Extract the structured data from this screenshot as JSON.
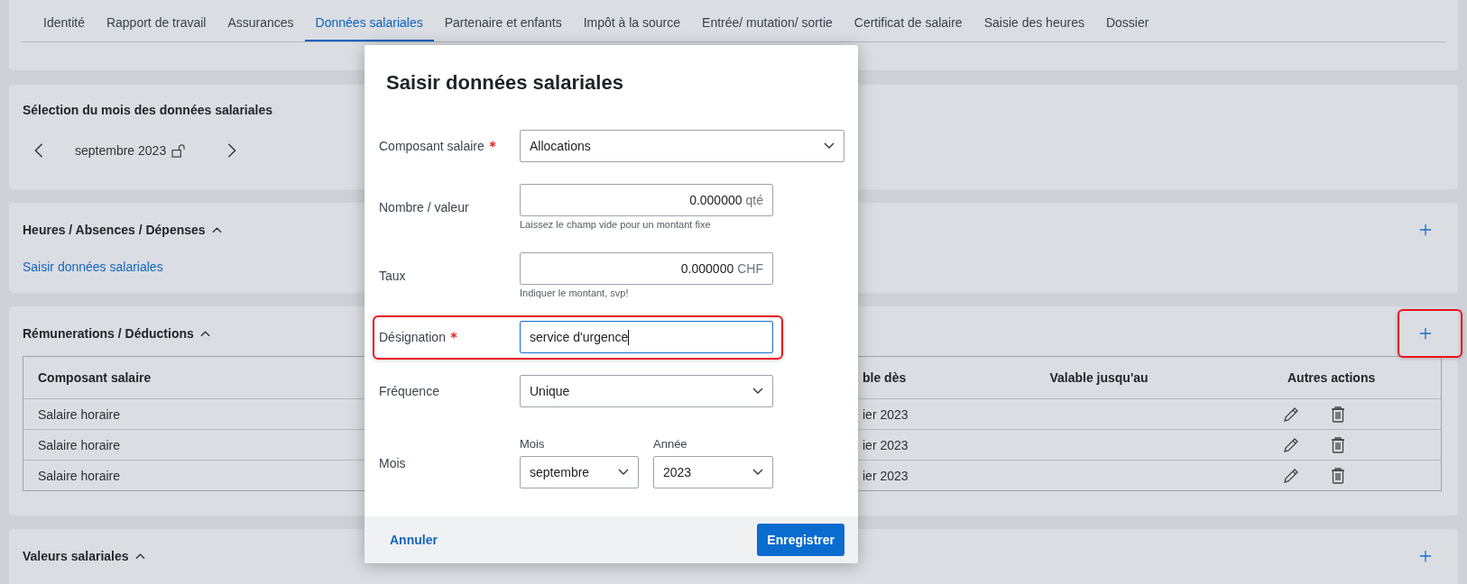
{
  "tabs": [
    {
      "label": "Identité",
      "selected": false
    },
    {
      "label": "Rapport de travail",
      "selected": false
    },
    {
      "label": "Assurances",
      "selected": false
    },
    {
      "label": "Données salariales",
      "selected": true
    },
    {
      "label": "Partenaire et enfants",
      "selected": false
    },
    {
      "label": "Impôt à la source",
      "selected": false
    },
    {
      "label": "Entrée/ mutation/ sortie",
      "selected": false
    },
    {
      "label": "Certificat de salaire",
      "selected": false
    },
    {
      "label": "Saisie des heures",
      "selected": false
    },
    {
      "label": "Dossier",
      "selected": false
    }
  ],
  "month_selection": {
    "title": "Sélection du mois des données salariales",
    "month": "septembre 2023",
    "locked": false
  },
  "sections": [
    {
      "title": "Heures / Absences / Dépenses",
      "expanded": true,
      "add_highlighted": false,
      "link": "Saisir données salariales"
    },
    {
      "title": "Rémunerations / Déductions",
      "expanded": true,
      "add_highlighted": true,
      "table": {
        "columns": [
          "Composant salaire",
          "ble dès",
          "Valable jusqu'au",
          "Autres actions"
        ],
        "rows": [
          {
            "component": "Salaire horaire",
            "column_2": "ier 2023"
          },
          {
            "component": "Salaire horaire",
            "column_2": "ier 2023"
          },
          {
            "component": "Salaire horaire",
            "column_2": "ier 2023"
          }
        ]
      }
    },
    {
      "title": "Valeurs salariales",
      "expanded": true,
      "add_highlighted": false
    }
  ],
  "dialog": {
    "title": "Saisir données salariales",
    "fields": [
      {
        "kind": "select",
        "label": "Composant salaire",
        "required": true,
        "wide": true,
        "value": "Allocations",
        "highlighted": false
      },
      {
        "kind": "number",
        "label": "Nombre / valeur",
        "required": false,
        "value": "0.000000",
        "unit": "qté",
        "hint": "Laissez le champ vide pour un montant fixe",
        "highlighted": false
      },
      {
        "kind": "number",
        "label": "Taux",
        "required": false,
        "value": "0.000000",
        "unit": "CHF",
        "hint": "Indiquer le montant, svp!",
        "highlighted": false
      },
      {
        "kind": "text",
        "label": "Désignation",
        "required": true,
        "value": "service d'urgence",
        "focused": true,
        "highlighted": true
      },
      {
        "kind": "select",
        "label": "Fréquence",
        "required": false,
        "wide": false,
        "value": "Unique",
        "highlighted": false
      },
      {
        "kind": "month_year",
        "label": "Mois",
        "required": false,
        "highlighted": false,
        "parts": [
          {
            "label": "Mois",
            "value": "septembre"
          },
          {
            "label": "Année",
            "value": "2023"
          }
        ]
      }
    ],
    "cancel": "Annuler",
    "save": "Enregistrer"
  }
}
